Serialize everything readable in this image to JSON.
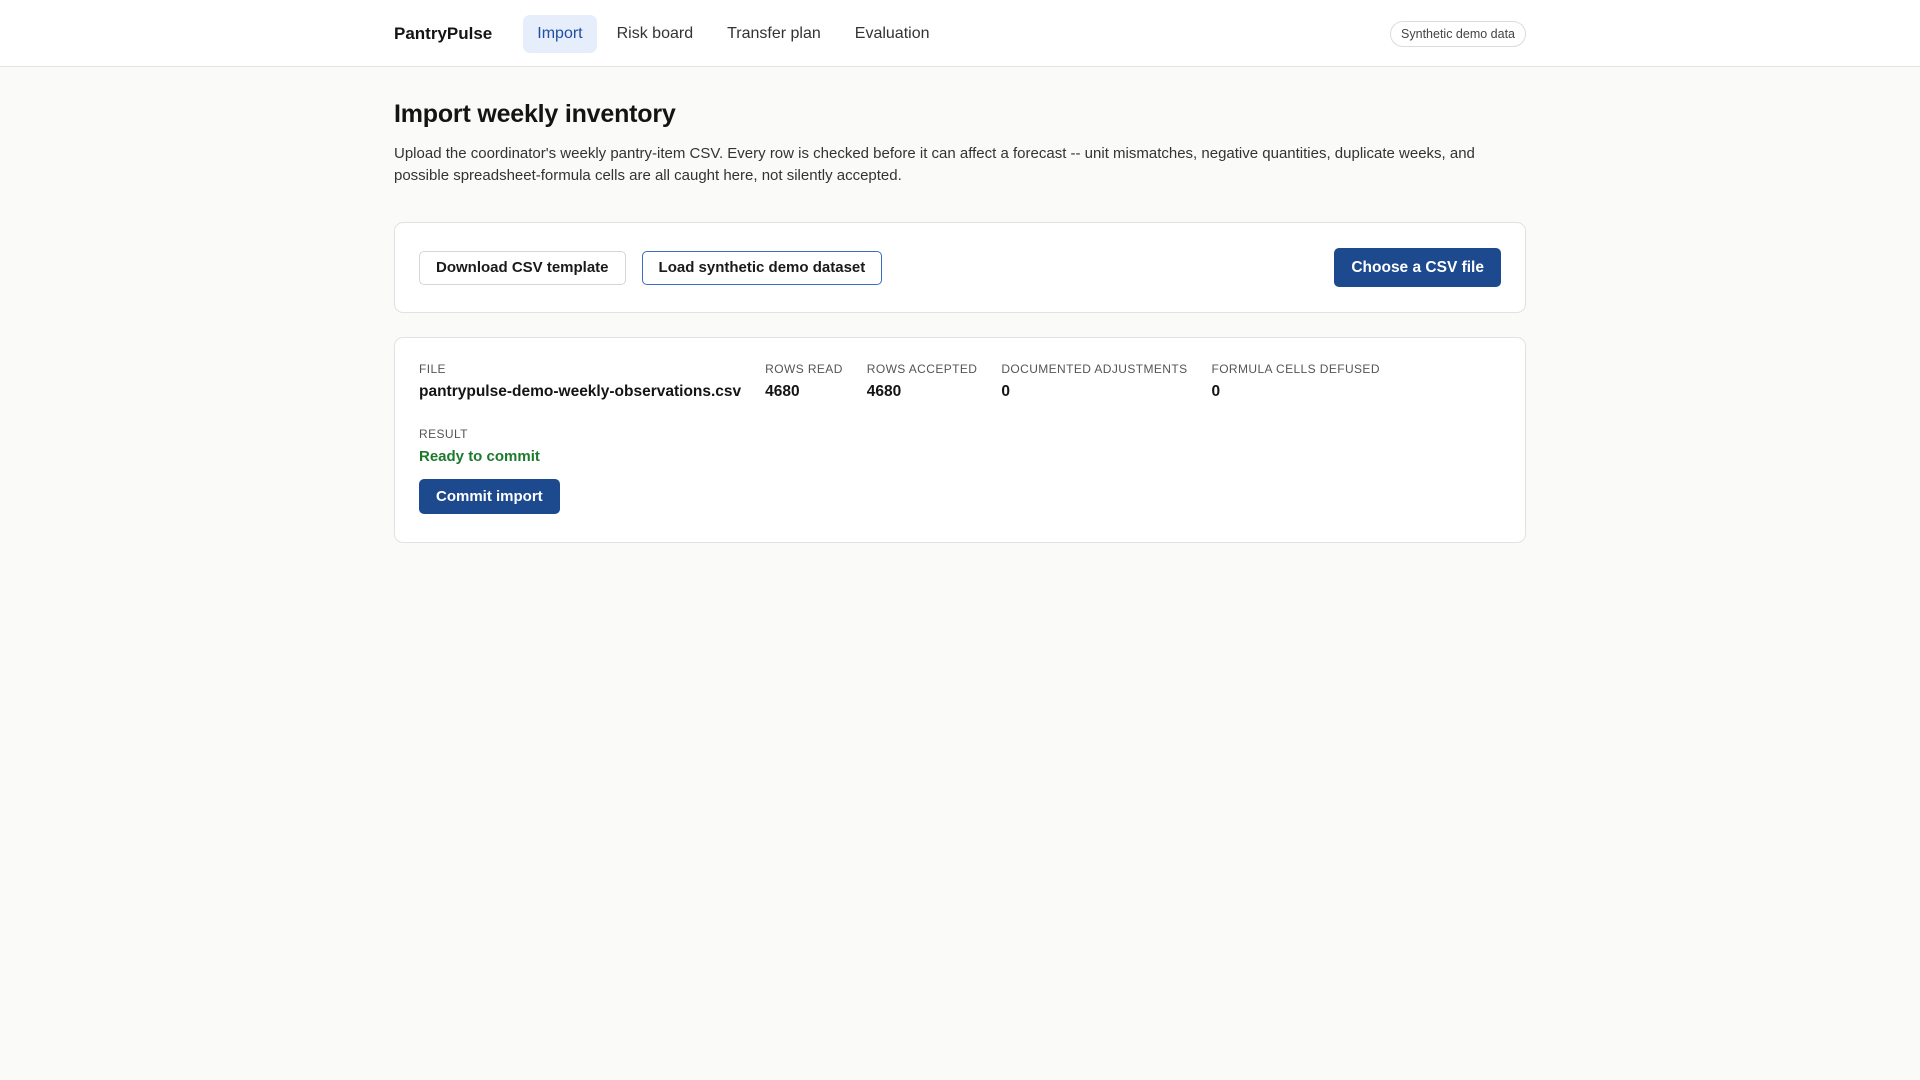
{
  "header": {
    "brand": "PantryPulse",
    "nav": [
      {
        "label": "Import",
        "active": true
      },
      {
        "label": "Risk board",
        "active": false
      },
      {
        "label": "Transfer plan",
        "active": false
      },
      {
        "label": "Evaluation",
        "active": false
      }
    ],
    "badge": "Synthetic demo data"
  },
  "page": {
    "title": "Import weekly inventory",
    "description": "Upload the coordinator's weekly pantry-item CSV. Every row is checked before it can affect a forecast -- unit mismatches, negative quantities, duplicate weeks, and possible spreadsheet-formula cells are all caught here, not silently accepted."
  },
  "actions": {
    "download_template": "Download CSV template",
    "load_demo": "Load synthetic demo dataset",
    "choose_file": "Choose a CSV file"
  },
  "result": {
    "file_label": "FILE",
    "file_value": "pantrypulse-demo-weekly-observations.csv",
    "rows_read_label": "ROWS READ",
    "rows_read_value": "4680",
    "rows_accepted_label": "ROWS ACCEPTED",
    "rows_accepted_value": "4680",
    "adjustments_label": "DOCUMENTED ADJUSTMENTS",
    "adjustments_value": "0",
    "formula_label": "FORMULA CELLS DEFUSED",
    "formula_value": "0",
    "result_label": "RESULT",
    "result_value": "Ready to commit",
    "commit_label": "Commit import"
  },
  "colors": {
    "primary": "#1d4a8f",
    "success": "#1c7a2c",
    "nav_active_bg": "#e6eefb"
  }
}
